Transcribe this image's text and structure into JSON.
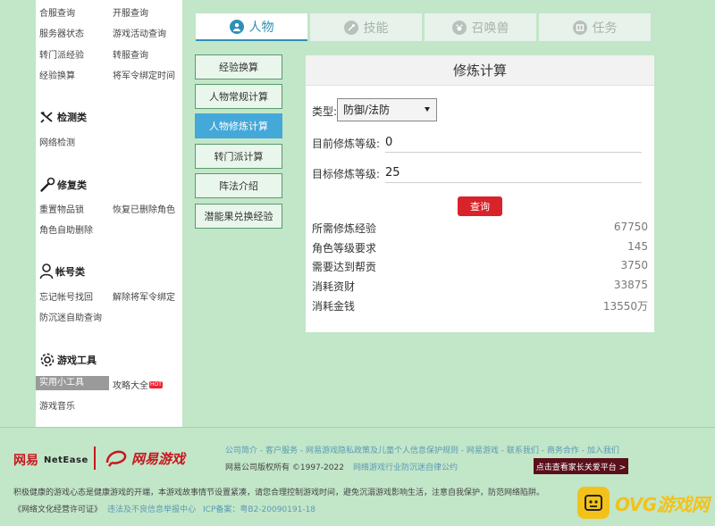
{
  "sidebar": {
    "top_links": [
      "合服查询",
      "开服查询",
      "服务器状态",
      "游戏活动查询",
      "转门派经验",
      "转服查询",
      "经验换算",
      "将军令绑定时间"
    ],
    "sections": [
      {
        "title": "检测类",
        "icon": "wrench-crossed-icon",
        "links": [
          "网络检测"
        ]
      },
      {
        "title": "修复类",
        "icon": "wrench-icon",
        "links": [
          "重置物品锁",
          "恢复已删除角色",
          "角色自助删除"
        ]
      },
      {
        "title": "帐号类",
        "icon": "user-icon",
        "links": [
          "忘记帐号找回",
          "解除将军令绑定",
          "防沉迷自助查询"
        ]
      },
      {
        "title": "游戏工具",
        "icon": "gear-icon",
        "links": [
          "实用小工具",
          "攻略大全",
          "游戏音乐"
        ],
        "badge": "HOT"
      }
    ]
  },
  "tabs": [
    {
      "label": "人物",
      "icon": "person-icon",
      "active": true
    },
    {
      "label": "技能",
      "icon": "skill-icon",
      "active": false
    },
    {
      "label": "召唤兽",
      "icon": "pet-icon",
      "active": false
    },
    {
      "label": "任务",
      "icon": "book-icon",
      "active": false
    }
  ],
  "sub_buttons": [
    {
      "label": "经验换算",
      "active": false
    },
    {
      "label": "人物常规计算",
      "active": false
    },
    {
      "label": "人物修炼计算",
      "active": true
    },
    {
      "label": "转门派计算",
      "active": false
    },
    {
      "label": "阵法介绍",
      "active": false
    },
    {
      "label": "潜能果兑换经验",
      "active": false
    }
  ],
  "panel": {
    "title": "修炼计算",
    "type_label": "类型:",
    "type_value": "防御/法防",
    "current_label": "目前修炼等级:",
    "current_value": "0",
    "target_label": "目标修炼等级:",
    "target_value": "25",
    "query_label": "查询",
    "results": [
      {
        "label": "所需修炼经验",
        "value": "67750"
      },
      {
        "label": "角色等级要求",
        "value": "145"
      },
      {
        "label": "需要达到帮贡",
        "value": "3750"
      },
      {
        "label": "消耗资财",
        "value": "33875"
      },
      {
        "label": "消耗金钱",
        "value": "13550万"
      }
    ]
  },
  "footer": {
    "links_line": "公司简介 - 客户服务 - 网易游戏隐私政策及儿童个人信息保护规则 - 网易游戏 - 联系我们 - 商务合作 - 加入我们",
    "copyright": "网易公司版权所有 ©1997-2022",
    "self_discipline": "网络游戏行业防沉迷自律公约",
    "parent_button": "点击查看家长关爱平台 >",
    "notice": "积极健康的游戏心态是健康游戏的开端，本游戏故事情节设置紧凑，请您合理控制游戏时间，避免沉溺游戏影响生活，注意自我保护，防范网络陷阱。",
    "license": "《网络文化经营许可证》",
    "report_center": "违法及不良信息举报中心",
    "icp": "ICP备案：粤B2-20090191-18"
  },
  "logos": {
    "netease_cn": "网易",
    "netease_en": "NetEase",
    "games_cn": "网易游戏",
    "watermark": "OVG游戏网"
  },
  "colors": {
    "background": "#c2e6c8",
    "active_blue": "#2e90b8",
    "button_blue": "#44a8d8",
    "query_red": "#d8232a",
    "brand_red": "#c8161d"
  }
}
